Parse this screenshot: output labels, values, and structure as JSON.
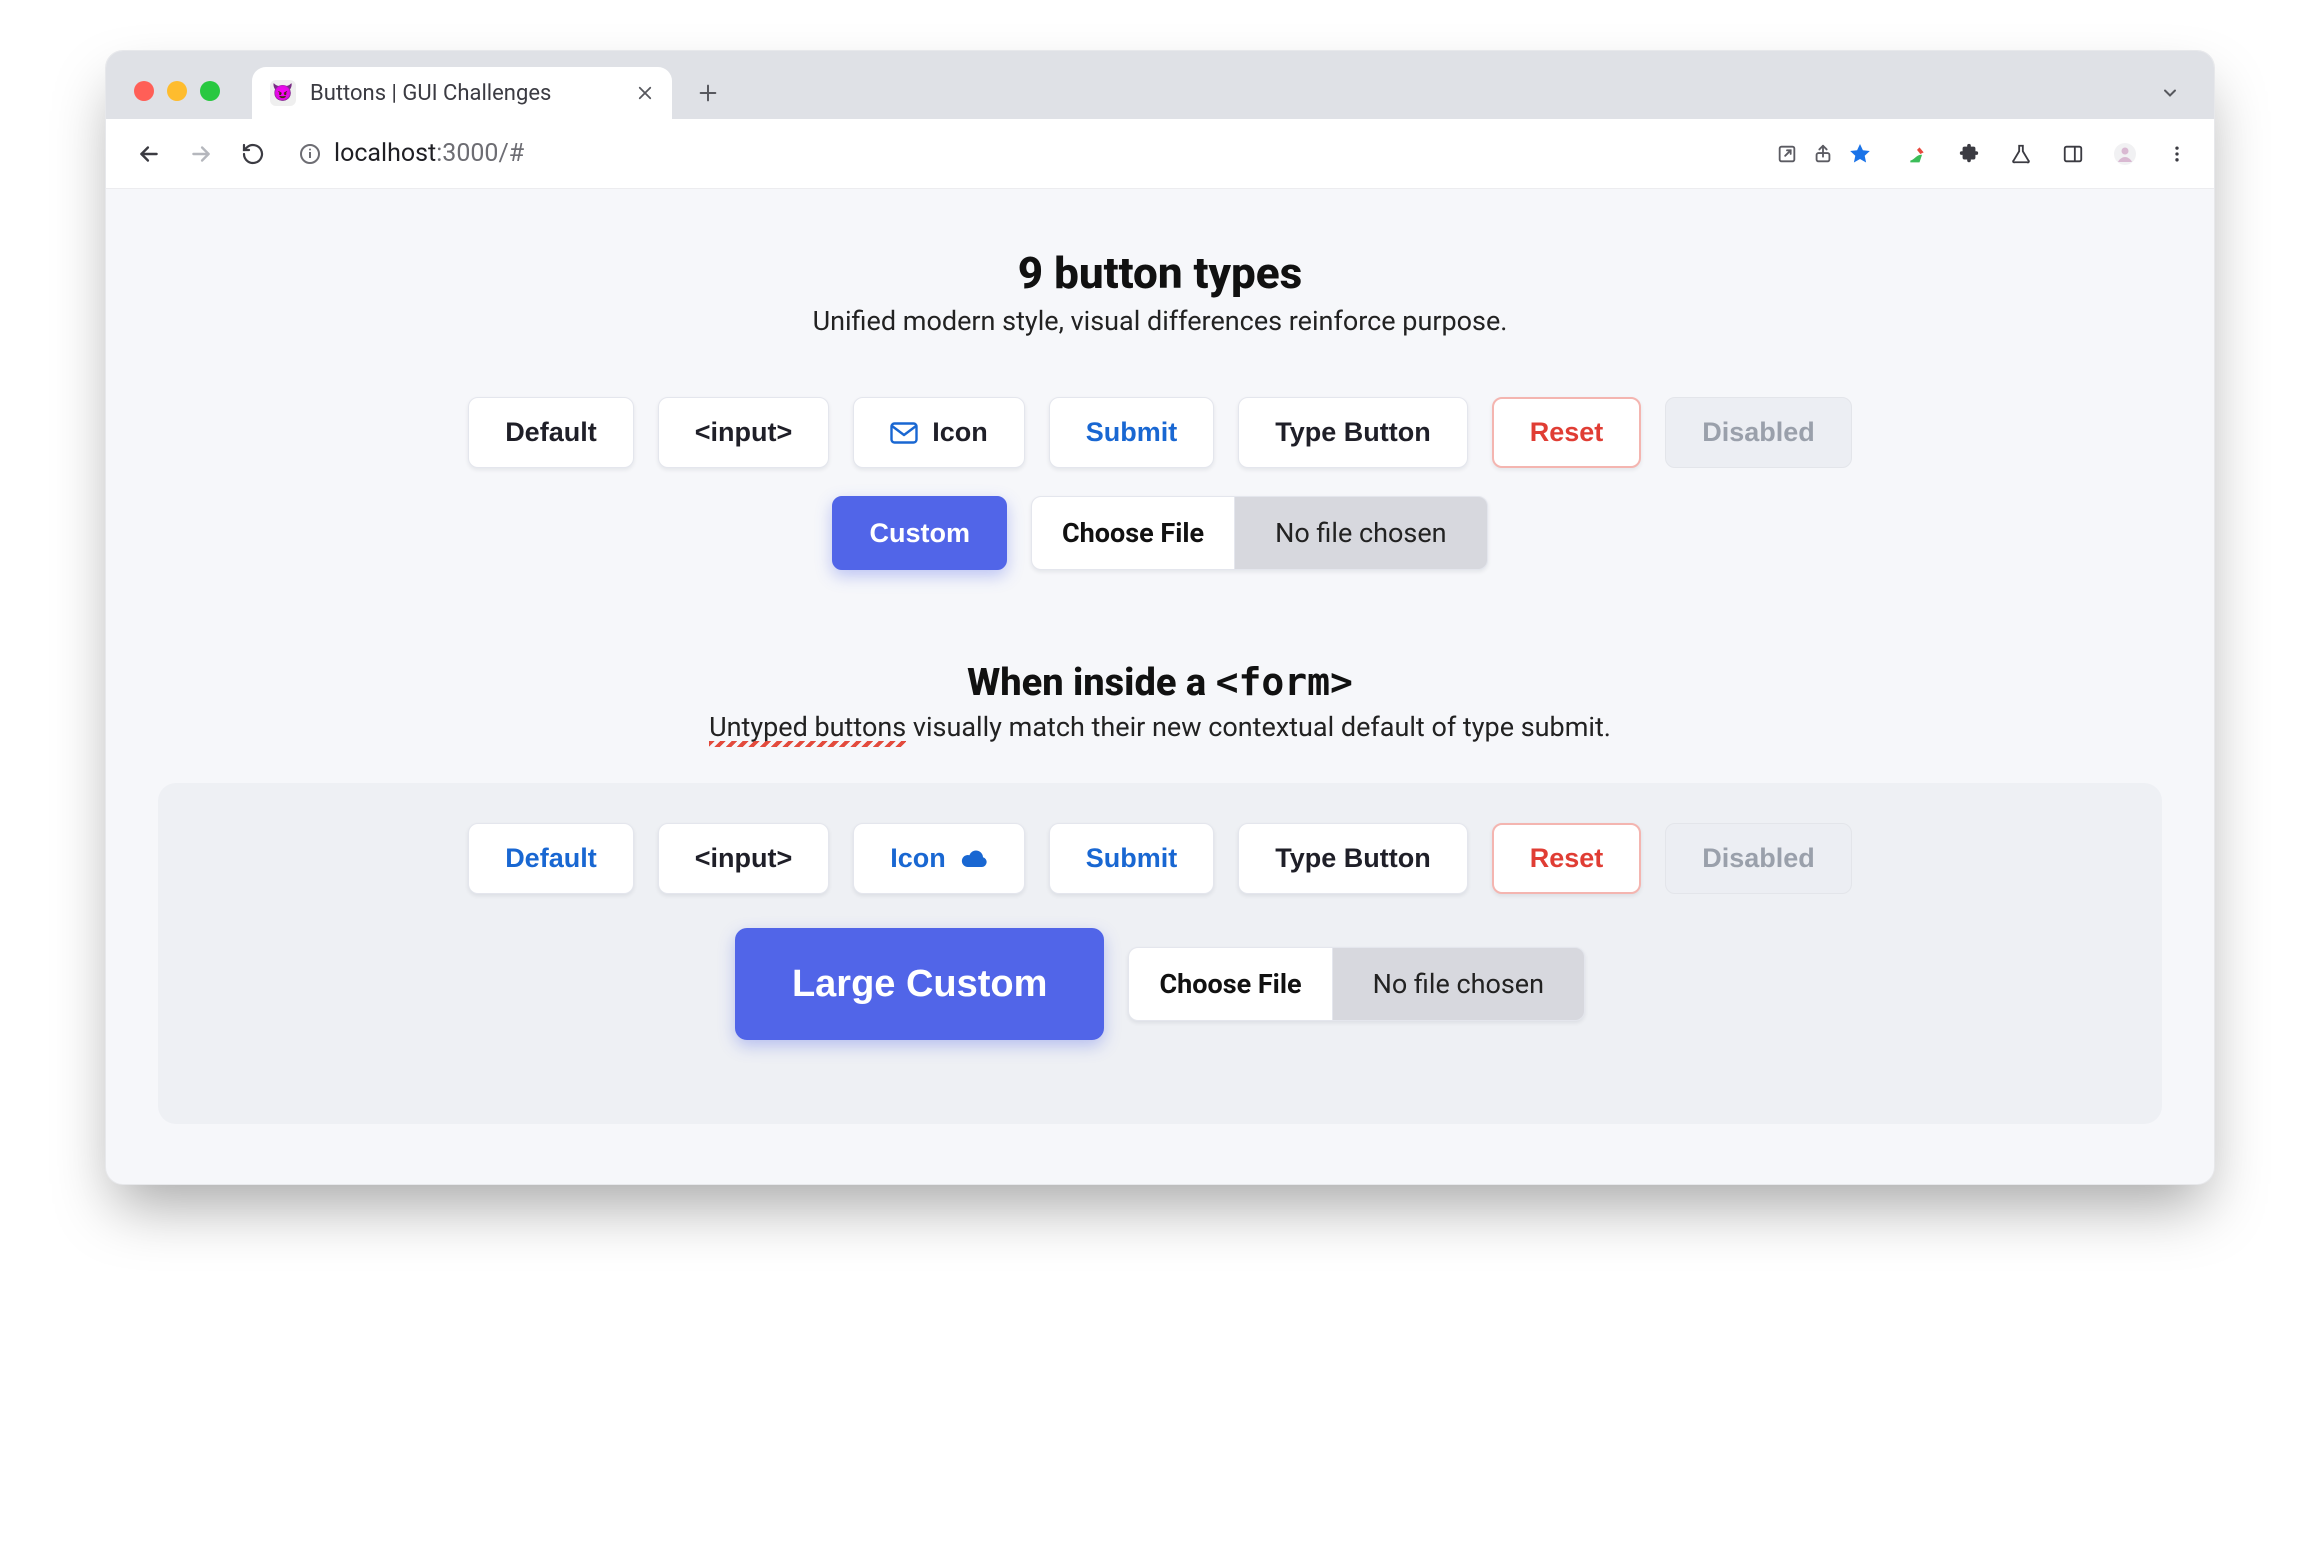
{
  "browser": {
    "tab": {
      "title": "Buttons | GUI Challenges",
      "favicon": "😈"
    },
    "url": {
      "host": "localhost",
      "port": ":3000",
      "path": "/#"
    }
  },
  "section1": {
    "heading": "9 button types",
    "sub": "Unified modern style, visual differences reinforce purpose.",
    "buttons": {
      "default": "Default",
      "input": "<input>",
      "icon": "Icon",
      "submit": "Submit",
      "type_button": "Type Button",
      "reset": "Reset",
      "disabled": "Disabled",
      "custom": "Custom"
    },
    "file": {
      "choose": "Choose File",
      "label": "No file chosen"
    }
  },
  "section2": {
    "heading_prefix": "When inside a ",
    "heading_code": "<form>",
    "sub_underlined": "Untyped buttons",
    "sub_rest": " visually match their new contextual default of type submit.",
    "buttons": {
      "default": "Default",
      "input": "<input>",
      "icon": "Icon",
      "submit": "Submit",
      "type_button": "Type Button",
      "reset": "Reset",
      "disabled": "Disabled",
      "large_custom": "Large Custom"
    },
    "file": {
      "choose": "Choose File",
      "label": "No file chosen"
    }
  }
}
